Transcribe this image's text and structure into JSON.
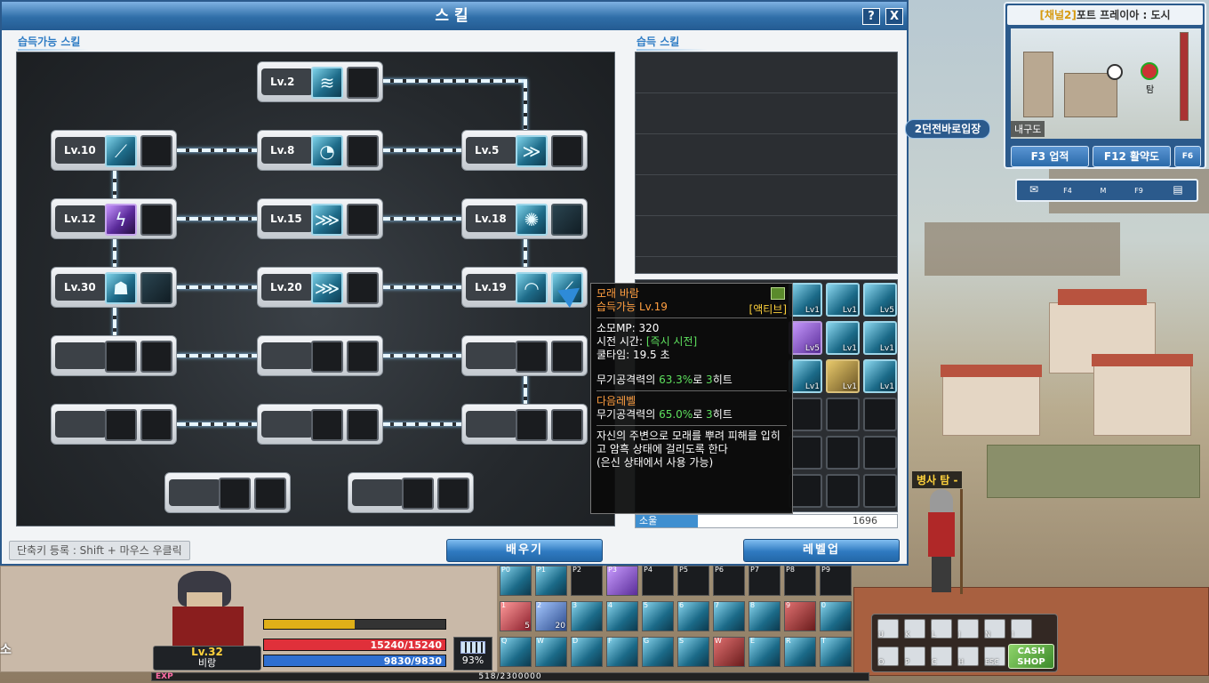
{
  "skill_window": {
    "title": "스킬",
    "help_label": "?",
    "close_label": "X",
    "acquirable_label": "습득가능 스킬",
    "learned_label": "습득 스킬",
    "tree_nodes": [
      {
        "level": "Lv.2"
      },
      {
        "level": "Lv.10"
      },
      {
        "level": "Lv.8"
      },
      {
        "level": "Lv.5"
      },
      {
        "level": "Lv.12"
      },
      {
        "level": "Lv.15"
      },
      {
        "level": "Lv.18"
      },
      {
        "level": "Lv.30"
      },
      {
        "level": "Lv.20"
      },
      {
        "level": "Lv.19"
      }
    ],
    "quick_slot_levels": [
      "Lv1",
      "Lv5",
      "Lv5",
      "Lv1",
      "Lv1",
      "Lv1",
      "Lv1",
      "Lv1"
    ],
    "soul_label": "소울",
    "soul_value": "1696",
    "shortcut_hint": "단축키 등록 : Shift + 마우스 우클릭",
    "learn_button": "배우기",
    "levelup_button": "레벨업"
  },
  "tooltip": {
    "name": "모래 바람",
    "availability": "습득가능 Lv.19",
    "type": "[액티브]",
    "mp_cost": "소모MP: 320",
    "cast_label": "시전 시간: ",
    "cast_value": "[즉시 시전]",
    "cooldown": "쿨타임: 19.5 초",
    "damage_prefix": "무기공격력의 ",
    "damage_pct": "63.3%",
    "damage_mid": "로 ",
    "damage_hits": "3",
    "damage_suffix": "히트",
    "next_level_label": "다음레벨",
    "next_damage_pct": "65.0%",
    "description": "자신의 주변으로 모래를 뿌려 피해를 입히고 암흑 상태에 걸리도록 한다",
    "note": "(은신 상태에서 사용 가능)"
  },
  "minimap": {
    "channel": "[채널2]",
    "map_name": "포트 프레이아 : 도시",
    "region": "내구도",
    "npc_label": "탐",
    "f3_button": "F3 업적",
    "f12_button": "F12 활약도",
    "f6_label": "F6",
    "quick_keys": [
      "F4",
      "M",
      "F9"
    ]
  },
  "dungeon_badge": "2던전바로입장",
  "npc_name": "병사 탐 -",
  "player": {
    "level": "Lv.32",
    "name": "비랑",
    "hp": "15240/15240",
    "mp": "9830/9830",
    "hp_ratio": 1.0,
    "mp_ratio": 1.0,
    "battery": "93%",
    "exp_label": "EXP",
    "exp": "518/2300000",
    "side_label": "소"
  },
  "hotkeys_row1": [
    "P0",
    "P1",
    "P2",
    "P3",
    "P4",
    "P5",
    "P6",
    "P7",
    "P8",
    "P9"
  ],
  "hotkeys_row2": [
    "1",
    "2",
    "3",
    "4",
    "5",
    "6",
    "7",
    "8",
    "9",
    "0"
  ],
  "hotkeys_row3": [
    "Q",
    "W",
    "D",
    "F",
    "G",
    "S",
    "W",
    "E",
    "R",
    "T"
  ],
  "hotkey_counts": [
    "5",
    "20"
  ],
  "menu_keys": [
    "U",
    "K",
    "L",
    "J",
    "N",
    "I",
    "O",
    "P",
    "C",
    "H",
    "ESC",
    "F11"
  ],
  "cash_shop": "CASH SHOP",
  "colors": {
    "accent": "#2f6ea8",
    "hp": "#e0303a",
    "mp": "#2f6fd0",
    "exp": "#ffd23c"
  }
}
